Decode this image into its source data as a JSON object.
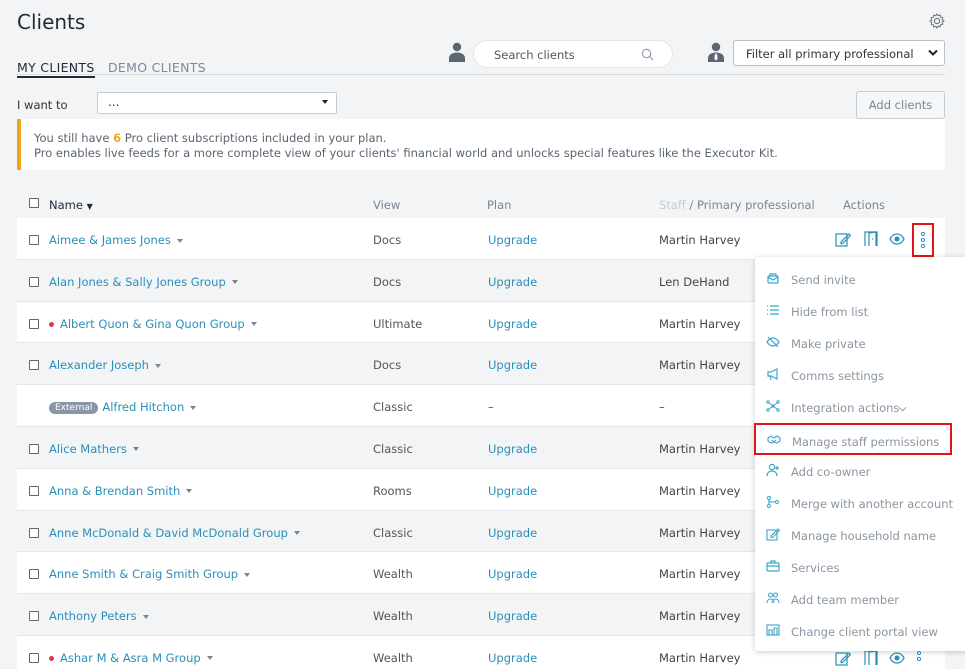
{
  "page": {
    "title": "Clients"
  },
  "tabs": [
    {
      "label": "MY CLIENTS"
    },
    {
      "label": "DEMO CLIENTS"
    }
  ],
  "search": {
    "placeholder": "Search clients"
  },
  "filter": {
    "selected": "Filter all primary professional"
  },
  "i_want": {
    "label": "I want to",
    "selected": "..."
  },
  "add_clients": {
    "label": "Add clients"
  },
  "notice": {
    "line1_pre": "You still have ",
    "count": "6",
    "line1_post": " Pro client subscriptions included in your plan.",
    "line2": "Pro enables live feeds for a more complete view of your clients' financial world and unlocks special features like the Executor Kit."
  },
  "table": {
    "headers": {
      "name": "Name",
      "view": "View",
      "plan": "Plan",
      "staff": "Staff",
      "sep": " / ",
      "primary": "Primary professional",
      "actions": "Actions"
    },
    "rows": [
      {
        "name": "Aimee & James Jones",
        "view": "Docs",
        "plan": "Upgrade",
        "staff": "Martin Harvey",
        "dot": false,
        "external": "",
        "checkbox": true
      },
      {
        "name": "Alan Jones & Sally Jones Group",
        "view": "Docs",
        "plan": "Upgrade",
        "staff": "Len DeHand",
        "dot": false,
        "external": "",
        "checkbox": true
      },
      {
        "name": "Albert Quon & Gina Quon Group",
        "view": "Ultimate",
        "plan": "Upgrade",
        "staff": "Martin Harvey",
        "dot": true,
        "external": "",
        "checkbox": true
      },
      {
        "name": "Alexander Joseph",
        "view": "Docs",
        "plan": "Upgrade",
        "staff": "Martin Harvey",
        "dot": false,
        "external": "",
        "checkbox": true
      },
      {
        "name": "Alfred Hitchon",
        "view": "Classic",
        "plan": "–",
        "staff": "–",
        "dot": false,
        "external": "External",
        "checkbox": false
      },
      {
        "name": "Alice Mathers",
        "view": "Classic",
        "plan": "Upgrade",
        "staff": "Martin Harvey",
        "dot": false,
        "external": "",
        "checkbox": true
      },
      {
        "name": "Anna & Brendan Smith",
        "view": "Rooms",
        "plan": "Upgrade",
        "staff": "Martin Harvey",
        "dot": false,
        "external": "",
        "checkbox": true
      },
      {
        "name": "Anne McDonald & David McDonald Group",
        "view": "Classic",
        "plan": "Upgrade",
        "staff": "Martin Harvey",
        "dot": false,
        "external": "",
        "checkbox": true
      },
      {
        "name": "Anne Smith & Craig Smith Group",
        "view": "Wealth",
        "plan": "Upgrade",
        "staff": "Martin Harvey",
        "dot": false,
        "external": "",
        "checkbox": true
      },
      {
        "name": "Anthony Peters",
        "view": "Wealth",
        "plan": "Upgrade",
        "staff": "Martin Harvey",
        "dot": false,
        "external": "",
        "checkbox": true
      },
      {
        "name": "Ashar M & Asra M Group",
        "view": "Wealth",
        "plan": "Upgrade",
        "staff": "Martin Harvey",
        "dot": true,
        "external": "",
        "checkbox": true
      }
    ]
  },
  "menu": {
    "items": [
      {
        "label": "Send invite",
        "icon": "send-invite-icon"
      },
      {
        "label": "Hide from list",
        "icon": "list-icon"
      },
      {
        "label": "Make private",
        "icon": "eye-off-icon"
      },
      {
        "label": "Comms settings",
        "icon": "megaphone-icon"
      },
      {
        "label": "Integration actions",
        "icon": "integration-icon"
      },
      {
        "label": "Manage staff permissions",
        "icon": "handshake-icon"
      },
      {
        "label": "Add co-owner",
        "icon": "add-user-icon"
      },
      {
        "label": "Merge with another account",
        "icon": "merge-icon"
      },
      {
        "label": "Manage household name",
        "icon": "edit-icon"
      },
      {
        "label": "Services",
        "icon": "briefcase-icon"
      },
      {
        "label": "Add team member",
        "icon": "team-icon"
      },
      {
        "label": "Change client portal view",
        "icon": "portal-icon"
      }
    ]
  },
  "colors": {
    "accent": "#2a8fb8",
    "warning": "#f0a51c",
    "highlight": "#e0141b",
    "menu_icon": "#3aa6c9"
  }
}
